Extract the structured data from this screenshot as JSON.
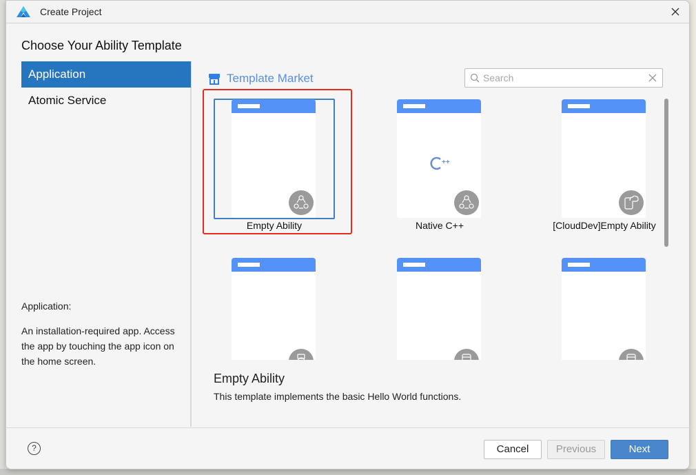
{
  "window": {
    "title": "Create Project",
    "close_icon": "close-icon",
    "logo_icon": "deveco-logo-icon"
  },
  "heading": "Choose Your Ability Template",
  "sidebar": {
    "items": [
      {
        "label": "Application",
        "active": true
      },
      {
        "label": "Atomic Service",
        "active": false
      }
    ],
    "description_title": "Application:",
    "description": "An installation-required app. Access the app by touching the app icon on the home screen."
  },
  "market": {
    "label": "Template Market",
    "icon": "store-icon",
    "accent": "#5b8fe0"
  },
  "search": {
    "placeholder": "Search",
    "value": ""
  },
  "templates": [
    {
      "name": "Empty Ability",
      "selected": true,
      "badge_icon": "ability-nodes-icon"
    },
    {
      "name": "Native C++",
      "selected": false,
      "badge_icon": "ability-nodes-icon",
      "center_icon": "cpp-icon"
    },
    {
      "name": "[CloudDev]Empty Ability",
      "selected": false,
      "badge_icon": "cloud-phone-icon"
    },
    {
      "name": "",
      "selected": false,
      "badge_icon": "watch-icon"
    },
    {
      "name": "",
      "selected": false,
      "badge_icon": "device-icon"
    },
    {
      "name": "",
      "selected": false,
      "badge_icon": "device-icon"
    }
  ],
  "detail": {
    "title": "Empty Ability",
    "description": "This template implements the basic Hello World functions."
  },
  "footer": {
    "help_label": "?",
    "cancel_label": "Cancel",
    "previous_label": "Previous",
    "next_label": "Next"
  },
  "colors": {
    "selection": "#2675bf",
    "primary_button": "#4a86cb",
    "card_header": "#5592f7",
    "highlight_box": "#e8291c"
  }
}
